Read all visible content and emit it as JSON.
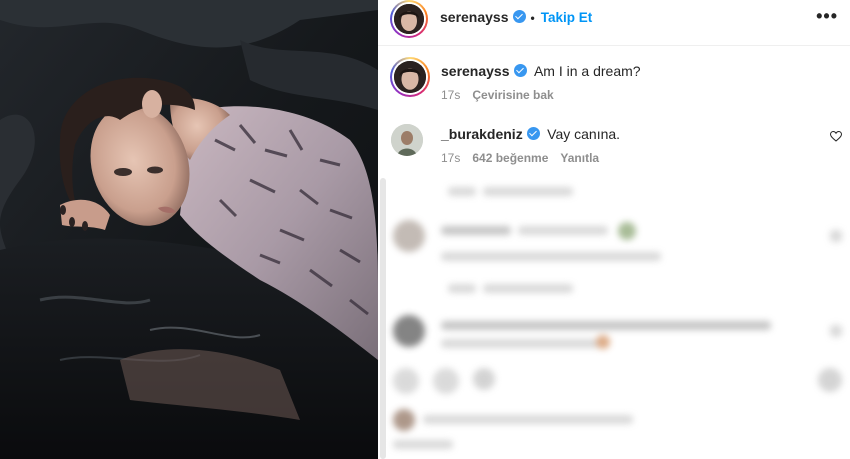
{
  "header": {
    "username": "serenayss",
    "separator": "•",
    "follow_label": "Takip Et",
    "more_label": "•••"
  },
  "caption": {
    "username": "serenayss",
    "text": "Am I in a dream?",
    "time": "17s",
    "translate_label": "Çevirisine bak"
  },
  "comment": {
    "username": "_burakdeniz",
    "text": "Vay canına.",
    "time": "17s",
    "likes": "642 beğenme",
    "reply_label": "Yanıtla"
  },
  "icons": {
    "verified": "verified-badge-icon",
    "heart": "heart-outline-icon",
    "more": "more-horizontal-icon"
  },
  "colors": {
    "accent": "#0095f6",
    "verified": "#3897f0",
    "meta_text": "#8e8e8e"
  }
}
